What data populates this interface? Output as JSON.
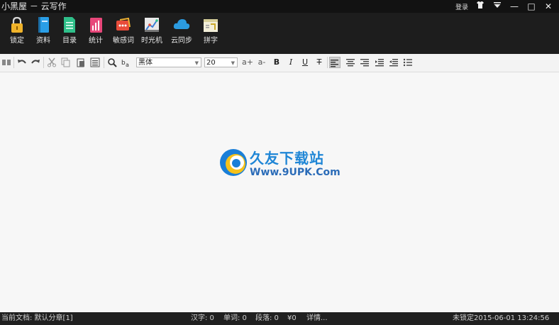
{
  "window": {
    "title": "小黑屋 － 云写作",
    "login_label": "登录",
    "skin_icon": "shirt-icon",
    "menu_icon": "menu-arrow-icon",
    "min_glyph": "—",
    "max_glyph": "□",
    "close_glyph": "✕"
  },
  "main_toolbar": {
    "items": [
      {
        "label": "锁定",
        "icon": "lock-icon"
      },
      {
        "label": "资料",
        "icon": "book-icon"
      },
      {
        "label": "目录",
        "icon": "catalog-icon"
      },
      {
        "label": "统计",
        "icon": "chart-icon"
      },
      {
        "label": "敏感词",
        "icon": "sensitive-word-icon"
      },
      {
        "label": "时光机",
        "icon": "time-machine-icon"
      },
      {
        "label": "云同步",
        "icon": "cloud-icon"
      },
      {
        "label": "拼字",
        "icon": "spell-icon"
      }
    ]
  },
  "format_toolbar": {
    "font_value": "黑体",
    "size_value": "20",
    "bold": "B",
    "italic": "I",
    "underline": "U",
    "strike": "T",
    "font_up": "a+",
    "font_down": "a-"
  },
  "watermark": {
    "text": "久友下载站",
    "url": "Www.9UPK.Com"
  },
  "status": {
    "current_doc": "当前文档: 默认分章[1]",
    "hanzi": "汉字: 0",
    "words": "单词: 0",
    "paragraphs": "段落: 0",
    "money": "¥0",
    "detail": "详情...",
    "lock_state": "未锁定",
    "datetime": "2015-06-01 13:24:56"
  },
  "colors": {
    "lock": "#f0b32a",
    "book": "#2a9ee6",
    "catalog": "#2fc08a",
    "chart": "#e8477a",
    "sensitive": "#e84c3a",
    "cloud": "#2b9be0"
  }
}
